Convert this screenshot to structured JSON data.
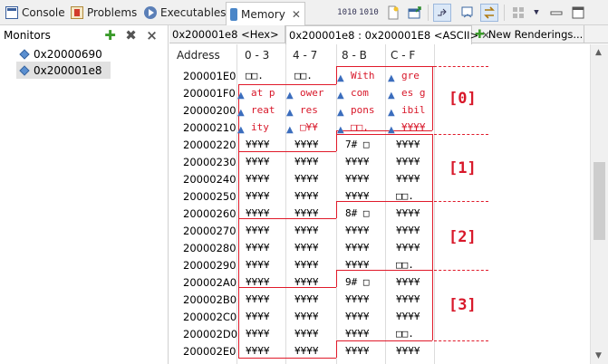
{
  "tabs": [
    {
      "label": "Console",
      "icon": "console-icon"
    },
    {
      "label": "Problems",
      "icon": "problems-icon"
    },
    {
      "label": "Executables",
      "icon": "executables-icon"
    },
    {
      "label": "Memory",
      "icon": "memory-icon"
    }
  ],
  "close_glyph": "✕",
  "toolbar": {
    "btn1": "1010",
    "btn2": "1010"
  },
  "monitors": {
    "title": "Monitors",
    "items": [
      "0x20000690",
      "0x200001e8"
    ]
  },
  "renderings": {
    "tabs": [
      "0x200001e8 <Hex>",
      "0x200001e8 : 0x200001E8 <ASCII>"
    ],
    "new_label": "New Renderings..."
  },
  "grid": {
    "headers": [
      "Address",
      "0 - 3",
      "4 - 7",
      "8 - B",
      "C - F"
    ],
    "rows": [
      {
        "addr": "200001E0",
        "cells": [
          "□□.",
          "□□.",
          "With",
          "gre"
        ]
      },
      {
        "addr": "200001F0",
        "cells": [
          "at p",
          "ower",
          "com",
          "es g"
        ]
      },
      {
        "addr": "20000200",
        "cells": [
          "reat",
          "res",
          "pons",
          "ibil"
        ]
      },
      {
        "addr": "20000210",
        "cells": [
          "ity",
          "□¥¥",
          "□□.",
          "¥¥¥¥"
        ]
      },
      {
        "addr": "20000220",
        "cells": [
          "¥¥¥¥",
          "¥¥¥¥",
          "7# □",
          "¥¥¥¥"
        ]
      },
      {
        "addr": "20000230",
        "cells": [
          "¥¥¥¥",
          "¥¥¥¥",
          "¥¥¥¥",
          "¥¥¥¥"
        ]
      },
      {
        "addr": "20000240",
        "cells": [
          "¥¥¥¥",
          "¥¥¥¥",
          "¥¥¥¥",
          "¥¥¥¥"
        ]
      },
      {
        "addr": "20000250",
        "cells": [
          "¥¥¥¥",
          "¥¥¥¥",
          "¥¥¥¥",
          "□□."
        ]
      },
      {
        "addr": "20000260",
        "cells": [
          "¥¥¥¥",
          "¥¥¥¥",
          "8# □",
          "¥¥¥¥"
        ]
      },
      {
        "addr": "20000270",
        "cells": [
          "¥¥¥¥",
          "¥¥¥¥",
          "¥¥¥¥",
          "¥¥¥¥"
        ]
      },
      {
        "addr": "20000280",
        "cells": [
          "¥¥¥¥",
          "¥¥¥¥",
          "¥¥¥¥",
          "¥¥¥¥"
        ]
      },
      {
        "addr": "20000290",
        "cells": [
          "¥¥¥¥",
          "¥¥¥¥",
          "¥¥¥¥",
          "□□."
        ]
      },
      {
        "addr": "200002A0",
        "cells": [
          "¥¥¥¥",
          "¥¥¥¥",
          "9# □",
          "¥¥¥¥"
        ]
      },
      {
        "addr": "200002B0",
        "cells": [
          "¥¥¥¥",
          "¥¥¥¥",
          "¥¥¥¥",
          "¥¥¥¥"
        ]
      },
      {
        "addr": "200002C0",
        "cells": [
          "¥¥¥¥",
          "¥¥¥¥",
          "¥¥¥¥",
          "¥¥¥¥"
        ]
      },
      {
        "addr": "200002D0",
        "cells": [
          "¥¥¥¥",
          "¥¥¥¥",
          "¥¥¥¥",
          "□□."
        ]
      },
      {
        "addr": "200002E0",
        "cells": [
          "¥¥¥¥",
          "¥¥¥¥",
          "¥¥¥¥",
          "¥¥¥¥"
        ]
      }
    ],
    "labels": [
      "[0]",
      "[1]",
      "[2]",
      "[3]"
    ]
  },
  "colors": {
    "annotation": "#e01a2a",
    "text_red": "#d8182a",
    "selection": "#e1e1e1"
  }
}
